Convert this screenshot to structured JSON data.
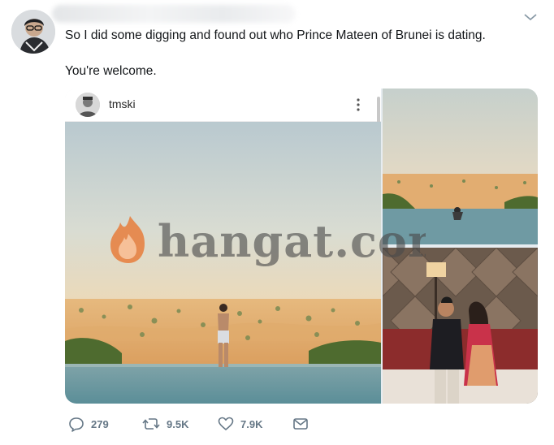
{
  "tweet": {
    "text_line1": "So I did some digging and found out who Prince Mateen of Brunei is dating.",
    "text_line2": "You're welcome."
  },
  "instagram_embed": {
    "username": "tmski"
  },
  "watermark": {
    "text": "hangat.com"
  },
  "actions": {
    "replies": "279",
    "retweets": "9.5K",
    "likes": "7.9K"
  },
  "icons": {
    "caret": "chevron-down-icon",
    "reply": "reply-icon",
    "retweet": "retweet-icon",
    "like": "heart-icon",
    "dm": "envelope-icon",
    "more": "more-vertical-icon"
  },
  "colors": {
    "text": "#14171a",
    "muted": "#657786",
    "watermark_flame": "#e8742e"
  }
}
